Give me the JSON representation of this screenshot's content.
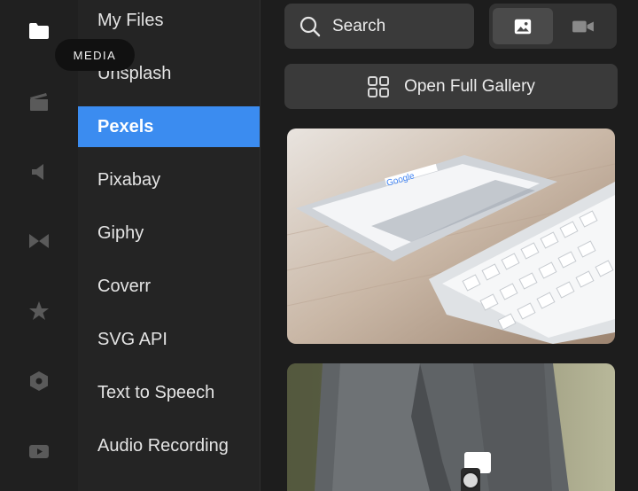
{
  "rail": {
    "tooltip": "MEDIA",
    "items": [
      {
        "icon": "folder-icon",
        "active": true
      },
      {
        "icon": "clapperboard-icon"
      },
      {
        "icon": "speaker-icon"
      },
      {
        "icon": "transition-icon"
      },
      {
        "icon": "star-icon"
      },
      {
        "icon": "hexagon-icon"
      },
      {
        "icon": "youtube-icon"
      }
    ]
  },
  "sources": {
    "items": [
      {
        "label": "My Files"
      },
      {
        "label": "Unsplash"
      },
      {
        "label": "Pexels",
        "active": true
      },
      {
        "label": "Pixabay"
      },
      {
        "label": "Giphy"
      },
      {
        "label": "Coverr"
      },
      {
        "label": "SVG API"
      },
      {
        "label": "Text to Speech"
      },
      {
        "label": "Audio Recording"
      }
    ]
  },
  "main": {
    "search_label": "Search",
    "media_types": [
      {
        "icon": "image-icon",
        "active": true
      },
      {
        "icon": "video-camera-icon"
      }
    ],
    "gallery_button_label": "Open Full Gallery"
  },
  "colors": {
    "accent": "#3b8cf0",
    "background": "#1d1d1d",
    "sidebar": "#242424",
    "button": "#3a3a3a"
  }
}
